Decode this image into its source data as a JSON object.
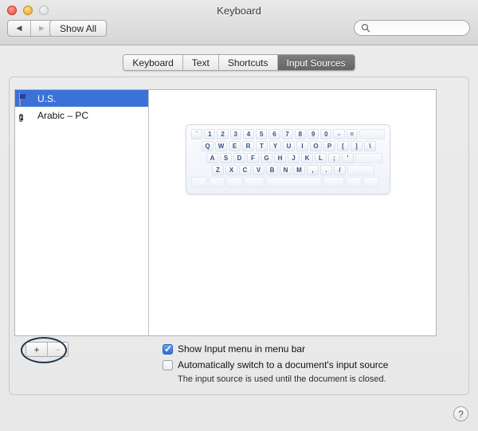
{
  "window": {
    "title": "Keyboard",
    "traffic_lights": [
      "close",
      "minimize",
      "zoom"
    ]
  },
  "toolbar": {
    "back_glyph": "◀",
    "forward_glyph": "▶",
    "show_all_label": "Show All",
    "search_placeholder": "",
    "search_value": "",
    "search_icon": "search-icon"
  },
  "tabs": [
    {
      "label": "Keyboard",
      "active": false
    },
    {
      "label": "Text",
      "active": false
    },
    {
      "label": "Shortcuts",
      "active": false
    },
    {
      "label": "Input Sources",
      "active": true
    }
  ],
  "input_sources": [
    {
      "label": "U.S.",
      "icon": "us-flag-icon",
      "selected": true
    },
    {
      "label": "Arabic – PC",
      "icon": "arabic-source-icon",
      "glyph": "ع",
      "selected": false
    }
  ],
  "keyboard_preview": {
    "rows": [
      [
        "`",
        "1",
        "2",
        "3",
        "4",
        "5",
        "6",
        "7",
        "8",
        "9",
        "0",
        "-",
        "="
      ],
      [
        "Q",
        "W",
        "E",
        "R",
        "T",
        "Y",
        "U",
        "I",
        "O",
        "P",
        "[",
        "]",
        "\\"
      ],
      [
        "A",
        "S",
        "D",
        "F",
        "G",
        "H",
        "J",
        "K",
        "L",
        ";",
        "'"
      ],
      [
        "Z",
        "X",
        "C",
        "V",
        "B",
        "N",
        "M",
        ",",
        ".",
        "/"
      ]
    ]
  },
  "list_controls": {
    "add_label": "+",
    "remove_label": "−",
    "annotation": "highlight-ellipse-around-add-button"
  },
  "options": {
    "show_input_menu": {
      "label": "Show Input menu in menu bar",
      "checked": true
    },
    "auto_switch": {
      "label": "Automatically switch to a document's input source",
      "checked": false,
      "hint": "The input source is used until the document is closed."
    }
  },
  "help": {
    "label": "?"
  },
  "colors": {
    "selection_blue": "#3b72d9",
    "tab_active_gray": "#6d6d6d",
    "key_text": "#3b5280",
    "annotation": "#1f3550"
  }
}
